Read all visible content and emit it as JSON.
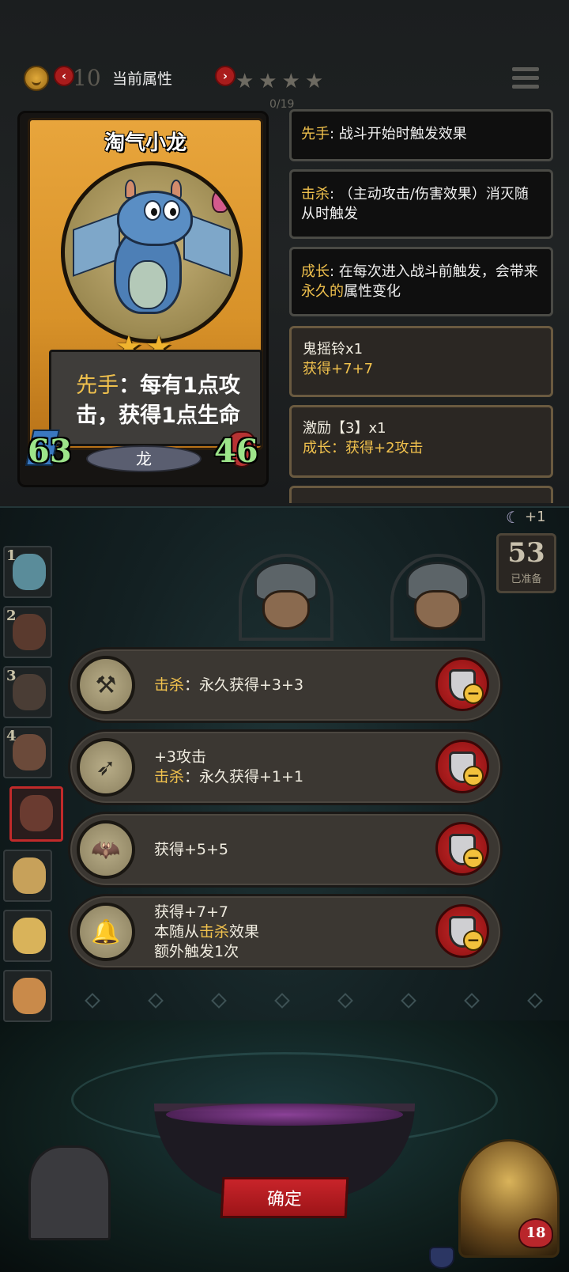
{
  "header": {
    "level_faded": "10",
    "title": "当前属性",
    "stars_faded": "★★★★",
    "progress_faded": "0/19"
  },
  "card": {
    "name": "淘气小龙",
    "stars": "★★",
    "ability": {
      "keyword": "先手",
      "text1": "：每有1点攻",
      "text2": "击，获得1点生命"
    },
    "attack": "63",
    "health": "46",
    "race": "龙"
  },
  "keywords": [
    {
      "keyword": "先手",
      "desc": ": 战斗开始时触发效果"
    },
    {
      "keyword": "击杀",
      "desc": ": （主动攻击/伤害效果）消灭随从时触发"
    },
    {
      "keyword": "成长",
      "desc_a": ": 在每次进入战斗前触发，会带来",
      "highlight": "永久的",
      "desc_b": "属性变化"
    }
  ],
  "items": [
    {
      "name": "鬼摇铃x1",
      "effect": "获得+7+7"
    },
    {
      "name": "激励【3】x1",
      "effect": "成长：获得+2攻击"
    }
  ],
  "roster": [
    "1",
    "2",
    "3",
    "4"
  ],
  "ready": {
    "moon": "☾",
    "bonus": "+1",
    "count": "53",
    "label": "已准备"
  },
  "relics": [
    {
      "icon": "scythe-icon",
      "line1_kw": "击杀",
      "line1": "：永久获得+3+3"
    },
    {
      "icon": "arrows-icon",
      "line0": "+3攻击",
      "line1_kw": "击杀",
      "line1": "：永久获得+1+1"
    },
    {
      "icon": "bat-icon",
      "line1": "获得+5+5"
    },
    {
      "icon": "bell-icon",
      "line0": "获得+7+7",
      "line1_pre": "本随从",
      "line1_kw": "击杀",
      "line1_post": "效果",
      "line2": "额外触发1次"
    }
  ],
  "footer": {
    "confirm": "确定",
    "hp": "18"
  },
  "colors": {
    "accent_gold": "#f0c14d",
    "confirm_red": "#c8242a",
    "stat_green": "#9de48a"
  }
}
